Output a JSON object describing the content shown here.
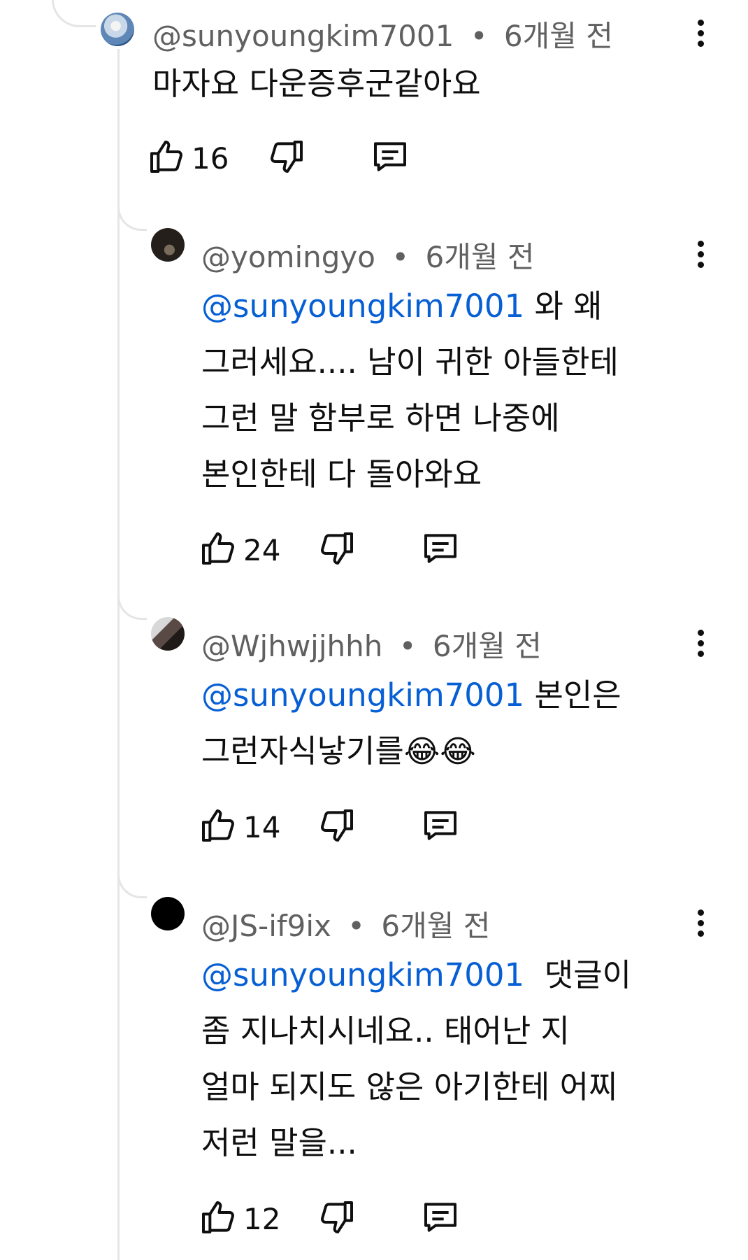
{
  "main_comment": {
    "username": "@sunyoungkim7001",
    "separator": "•",
    "time": "6개월 전",
    "text": "마자요 다운증후군같아요",
    "likes": "16"
  },
  "replies": [
    {
      "username": "@yomingyo",
      "separator": "•",
      "time": "6개월 전",
      "mention": "@sunyoungkim7001",
      "text_line1": " 와 왜",
      "text_rest": "그러세요.... 남이 귀한 아들한테\n그런 말 함부로 하면 나중에\n본인한테 다 돌아와요",
      "likes": "24"
    },
    {
      "username": "@Wjhwjjhhh",
      "separator": "•",
      "time": "6개월 전",
      "mention": "@sunyoungkim7001",
      "text_line1": " 본인은",
      "text_rest": "그런자식낳기를",
      "emoji": "😂😂",
      "likes": "14"
    },
    {
      "username": "@JS-if9ix",
      "separator": "•",
      "time": "6개월 전",
      "mention": "@sunyoungkim7001",
      "text_line1": "  댓글이",
      "text_rest": "좀 지나치시네요.. 태어난 지\n얼마 되지도 않은 아기한테 어찌\n저런 말을...",
      "likes": "12"
    }
  ],
  "icons": {
    "like": "thumbs-up-icon",
    "dislike": "thumbs-down-icon",
    "reply": "comment-reply-icon",
    "more": "more-vertical-icon"
  },
  "colors": {
    "mention": "#065fd4",
    "meta": "#606060",
    "text": "#0f0f0f",
    "thread_line": "#e5e5e5"
  }
}
